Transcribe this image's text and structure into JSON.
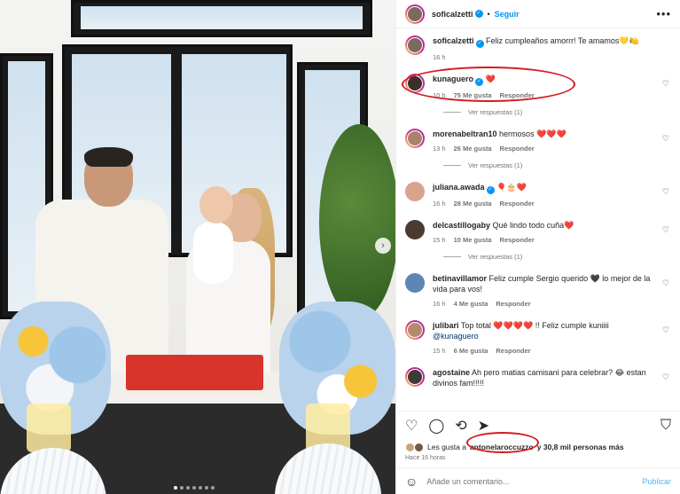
{
  "header": {
    "username": "soficalzetti",
    "follow_label": "Seguir",
    "more": "•••"
  },
  "comments": [
    {
      "username": "soficalzetti",
      "text": "Feliz cumpleaños amorrr! Te amamos💛🍋",
      "time": "16 h",
      "likes": "",
      "reply": "",
      "replies": ""
    },
    {
      "username": "kunaguero",
      "text": "❤️",
      "time": "10 h",
      "likes": "75 Me gusta",
      "reply": "Responder",
      "replies": "Ver respuestas (1)"
    },
    {
      "username": "morenabeltran10",
      "text": "hermosos ❤️❤️❤️",
      "time": "13 h",
      "likes": "26 Me gusta",
      "reply": "Responder",
      "replies": "Ver respuestas (1)"
    },
    {
      "username": "juliana.awada",
      "text": "🎈🎂❤️",
      "time": "16 h",
      "likes": "28 Me gusta",
      "reply": "Responder",
      "replies": ""
    },
    {
      "username": "delcastillogaby",
      "text": "Qué lindo todo cuña❤️",
      "time": "15 h",
      "likes": "10 Me gusta",
      "reply": "Responder",
      "replies": "Ver respuestas (1)"
    },
    {
      "username": "betinavillamor",
      "text": "Feliz cumple Sergio querido 🖤 lo mejor de la vida para vos!",
      "time": "16 h",
      "likes": "4 Me gusta",
      "reply": "Responder",
      "replies": ""
    },
    {
      "username": "julibari",
      "text": "Top total ❤️❤️❤️❤️ !! Feliz cumple kuniiii",
      "mention": "@kunaguero",
      "time": "15 h",
      "likes": "6 Me gusta",
      "reply": "Responder",
      "replies": ""
    },
    {
      "username": "agostaine",
      "text": "Ah pero matias camisani para celebrar? 😂 estan divinos fam!!!!!",
      "time": "",
      "likes": "",
      "reply": "",
      "replies": ""
    }
  ],
  "likes": {
    "prefix": "Les gusta a",
    "user": "antonelaroccuzzo",
    "suffix": "y 30,8 mil personas más"
  },
  "posted_ago": "Hace 16 horas",
  "add_comment": {
    "placeholder": "Añade un comentario...",
    "publish": "Publicar"
  },
  "icons": [
    "heart-icon",
    "comment-icon",
    "share-icon",
    "send-icon",
    "bookmark-icon",
    "emoji-icon"
  ],
  "colors": {
    "accent": "#0095f6",
    "highlight_ring": "#d51a22",
    "heart": "#e0245e"
  }
}
